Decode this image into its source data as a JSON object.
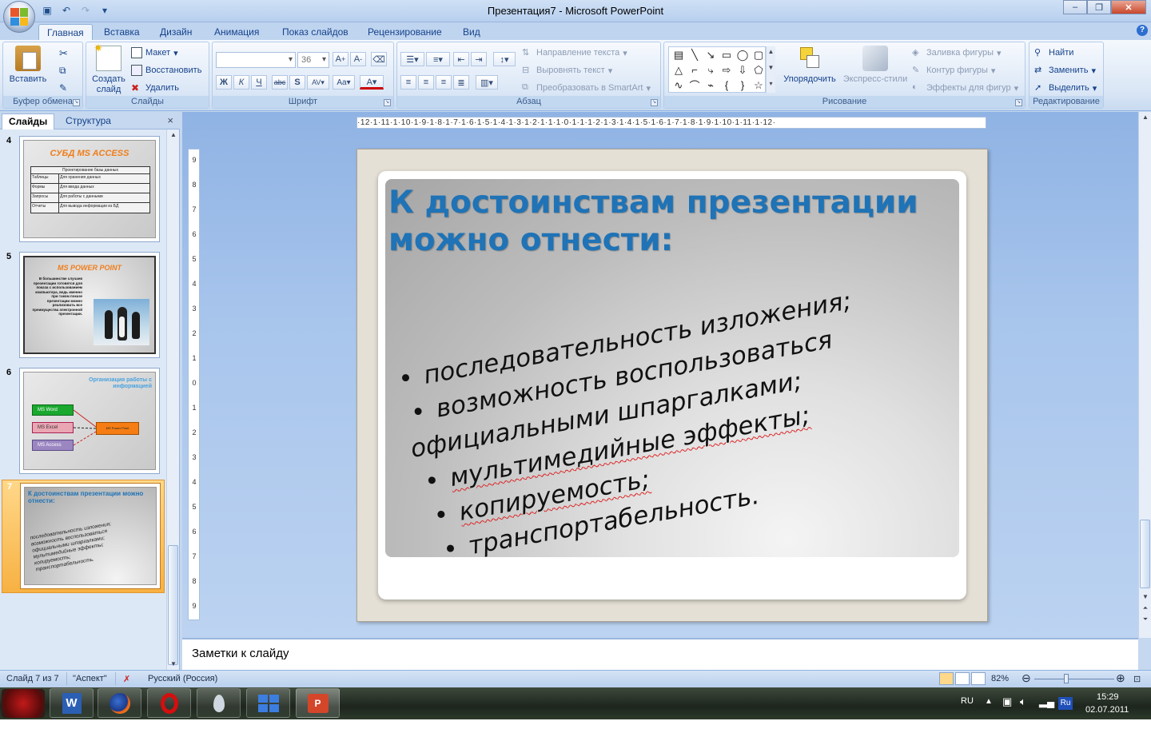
{
  "window": {
    "title": "Презентация7 - Microsoft PowerPoint",
    "minimize": "‒",
    "maximize": "❐",
    "close": "✕"
  },
  "tabs": [
    "Главная",
    "Вставка",
    "Дизайн",
    "Анимация",
    "Показ слайдов",
    "Рецензирование",
    "Вид"
  ],
  "ribbon": {
    "clipboard": {
      "title": "Буфер обмена",
      "paste": "Вставить"
    },
    "slides": {
      "title": "Слайды",
      "new_slide_1": "Создать",
      "new_slide_2": "слайд",
      "layout": "Макет",
      "reset": "Восстановить",
      "delete": "Удалить"
    },
    "font": {
      "title": "Шрифт",
      "font_name": "",
      "font_size": "36"
    },
    "paragraph": {
      "title": "Абзац",
      "text_direction": "Направление текста",
      "align_text": "Выровнять текст",
      "smartart": "Преобразовать в SmartArt"
    },
    "drawing": {
      "title": "Рисование",
      "arrange": "Упорядочить",
      "quick_styles": "Экспресс-стили",
      "shape_fill": "Заливка фигуры",
      "shape_outline": "Контур фигуры",
      "shape_effects": "Эффекты для фигур"
    },
    "editing": {
      "title": "Редактирование",
      "find": "Найти",
      "replace": "Заменить",
      "select": "Выделить"
    }
  },
  "slides_panel": {
    "tab_slides": "Слайды",
    "tab_outline": "Структура",
    "close": "×",
    "thumbnails": [
      {
        "num": "4",
        "title": "СУБД MS ACCESS",
        "table_header": "Проектирование базы данных",
        "rows": [
          [
            "Таблицы",
            "Для хранения данных"
          ],
          [
            "Формы",
            "Для ввода данных"
          ],
          [
            "Запросы",
            "Для работы с данными"
          ],
          [
            "Отчеты",
            "Для вывода информации из БД"
          ]
        ]
      },
      {
        "num": "5",
        "title": "MS POWER POINT",
        "text": "В большинстве случаев презентации готовятся для показа с использованием компьютера, ведь именно при таком показе презентации можно реализовать все преимущества электронной презентации."
      },
      {
        "num": "6",
        "title": "Организация работы с информацией",
        "boxes": [
          "MS Word",
          "MS Excel",
          "MS Access",
          "MS Power Point"
        ]
      },
      {
        "num": "7",
        "title": "К достоинствам презентации можно отнести:",
        "bullets": [
          "последовательность изложения;",
          "возможность воспользоваться",
          "официальными шпаргалками;",
          "мультимедийные эффекты;",
          "копируемость;",
          "транспортабельность."
        ]
      }
    ]
  },
  "ruler": {
    "horizontal": "·12·1·11·1·10·1·9·1·8·1·7·1·6·1·5·1·4·1·3·1·2·1·1·1·0·1·1·1·2·1·3·1·4·1·5·1·6·1·7·1·8·1·9·1·10·1·11·1·12·",
    "vertical": [
      "9",
      "8",
      "7",
      "6",
      "5",
      "4",
      "3",
      "2",
      "1",
      "0",
      "1",
      "2",
      "3",
      "4",
      "5",
      "6",
      "7",
      "8",
      "9"
    ]
  },
  "slide": {
    "title": "К достоинствам презентации можно отнести:",
    "bullets": [
      {
        "text": "последовательность изложения;",
        "bullet": true
      },
      {
        "text": "возможность воспользоваться",
        "bullet": true
      },
      {
        "text": "официальными шпаргалками;",
        "bullet": false
      },
      {
        "text": "мультимедийные эффекты;",
        "bullet": true
      },
      {
        "text": "копируемость;",
        "bullet": true
      },
      {
        "text": "транспортабельность.",
        "bullet": true
      }
    ]
  },
  "notes_placeholder": "Заметки к слайду",
  "status": {
    "slide_info": "Слайд 7 из 7",
    "theme": "\"Аспект\"",
    "language": "Русский (Россия)",
    "zoom": "82%",
    "zoom_level_percent": 82
  },
  "taskbar": {
    "lang": "RU",
    "time": "15:29",
    "date": "02.07.2011",
    "ime": "Ru"
  },
  "colors": {
    "title_blue": "#1f73b6",
    "ribbon_blue": "#15428b",
    "selection_orange": "#f7b142"
  }
}
